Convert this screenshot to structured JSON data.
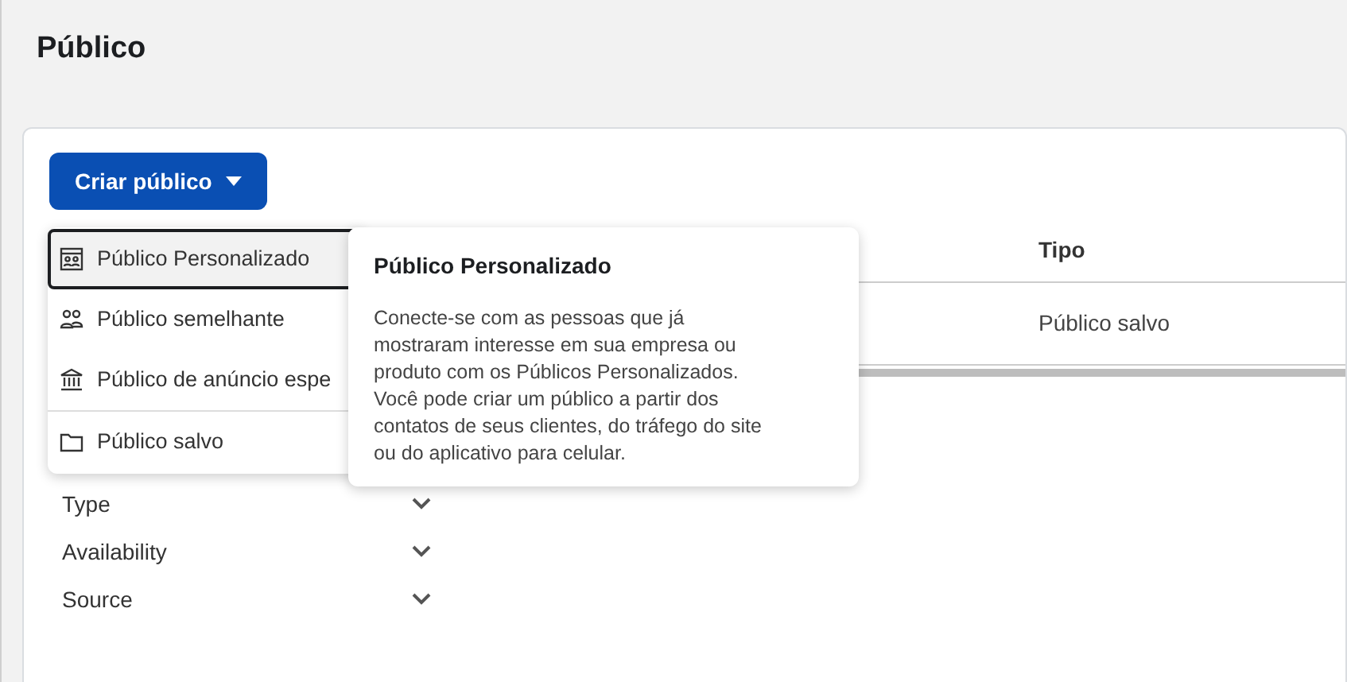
{
  "page": {
    "title": "Público"
  },
  "create_button": {
    "label": "Criar público",
    "expanded": true
  },
  "menu": [
    {
      "label": "Público Personalizado",
      "kind": "custom",
      "selected": true
    },
    {
      "label": "Público semelhante",
      "kind": "lookalike",
      "selected": false
    },
    {
      "label": "Público de anúncio espe",
      "kind": "special",
      "selected": false
    },
    {
      "label": "Público salvo",
      "kind": "folder",
      "selected": false
    }
  ],
  "tooltip": {
    "title": "Público Personalizado",
    "body": "Conecte-se com as pessoas que já mostraram interesse em sua empresa ou produto com os Públicos Personalizados. Você pode criar um público a partir dos contatos de seus clientes, do tráfego do site ou do aplicativo para celular."
  },
  "table": {
    "columns": [
      "Tipo"
    ],
    "rows": [
      [
        "Público salvo"
      ]
    ]
  },
  "filters": [
    {
      "label": "Type",
      "expanded": false
    },
    {
      "label": "Availability",
      "expanded": false
    },
    {
      "label": "Source",
      "expanded": false
    }
  ]
}
